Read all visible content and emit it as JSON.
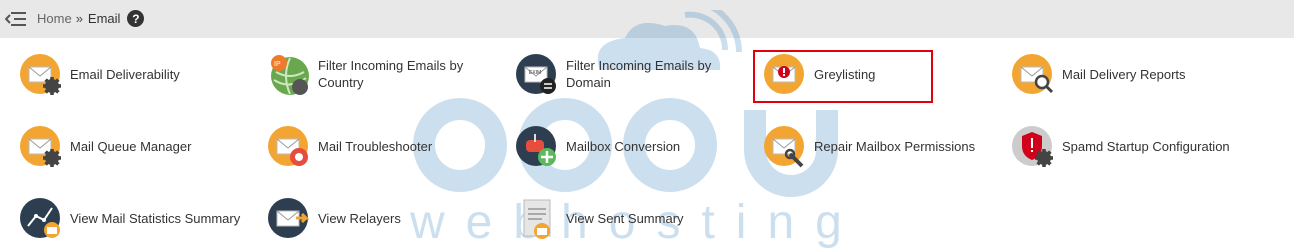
{
  "breadcrumb": {
    "home": "Home",
    "separator": "»",
    "current": "Email",
    "help": "?"
  },
  "watermark": {
    "brand": "accu",
    "tagline": "webhosting"
  },
  "items": [
    {
      "label": "Email Deliverability",
      "icon": "envelope-gear-icon"
    },
    {
      "label": "Filter Incoming Emails by Country",
      "icon": "globe-ip-icon"
    },
    {
      "label": "Filter Incoming Emails by Domain",
      "icon": "exim-exchange-icon"
    },
    {
      "label": "Greylisting",
      "icon": "envelope-alert-icon"
    },
    {
      "label": "Mail Delivery Reports",
      "icon": "envelope-search-icon"
    },
    {
      "label": "Mail Queue Manager",
      "icon": "envelope-gear-icon"
    },
    {
      "label": "Mail Troubleshooter",
      "icon": "envelope-lifebuoy-icon"
    },
    {
      "label": "Mailbox Conversion",
      "icon": "mailbox-plus-icon"
    },
    {
      "label": "Repair Mailbox Permissions",
      "icon": "envelope-wrench-icon"
    },
    {
      "label": "Spamd Startup Configuration",
      "icon": "shield-gear-icon"
    },
    {
      "label": "View Mail Statistics Summary",
      "icon": "stats-chart-icon"
    },
    {
      "label": "View Relayers",
      "icon": "envelope-relay-icon"
    },
    {
      "label": "View Sent Summary",
      "icon": "document-envelope-icon"
    }
  ],
  "colors": {
    "icon_orange": "#f2a531",
    "icon_dark": "#2d3e50",
    "highlight_border": "#e2000f",
    "topbar": "#e8e8e8"
  }
}
